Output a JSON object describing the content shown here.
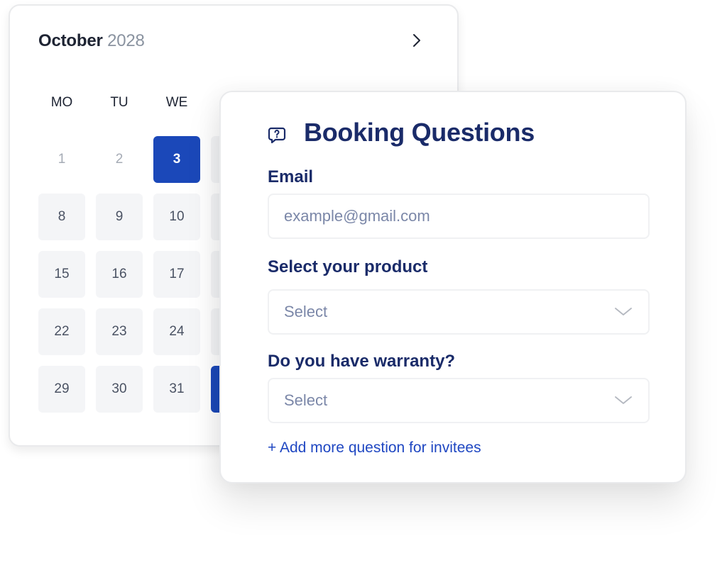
{
  "calendar": {
    "month": "October",
    "year": "2028",
    "next_icon": "chevron-right-icon",
    "weekdays": [
      "MO",
      "TU",
      "WE"
    ],
    "weeks": [
      [
        {
          "label": "1",
          "state": "muted"
        },
        {
          "label": "2",
          "state": "muted"
        },
        {
          "label": "3",
          "state": "selected"
        }
      ],
      [
        {
          "label": "8",
          "state": "default"
        },
        {
          "label": "9",
          "state": "default"
        },
        {
          "label": "10",
          "state": "default"
        }
      ],
      [
        {
          "label": "15",
          "state": "default"
        },
        {
          "label": "16",
          "state": "default"
        },
        {
          "label": "17",
          "state": "default"
        }
      ],
      [
        {
          "label": "22",
          "state": "default"
        },
        {
          "label": "23",
          "state": "default"
        },
        {
          "label": "24",
          "state": "default"
        }
      ],
      [
        {
          "label": "29",
          "state": "default"
        },
        {
          "label": "30",
          "state": "default"
        },
        {
          "label": "31",
          "state": "default"
        }
      ]
    ],
    "hidden_column_states": [
      "default",
      "default",
      "default",
      "selected"
    ]
  },
  "booking": {
    "icon": "question-chat-icon",
    "title": "Booking Questions",
    "email": {
      "label": "Email",
      "placeholder": "example@gmail.com",
      "value": ""
    },
    "product": {
      "label": "Select your product",
      "placeholder": "Select",
      "value": ""
    },
    "warranty": {
      "label": "Do you have warranty?",
      "placeholder": "Select",
      "value": ""
    },
    "add_link": "+ Add more question for invitees"
  },
  "colors": {
    "accent": "#1b48b9",
    "heading": "#1a2b69",
    "link": "#1f47c2",
    "day_bg": "#f4f5f7"
  }
}
